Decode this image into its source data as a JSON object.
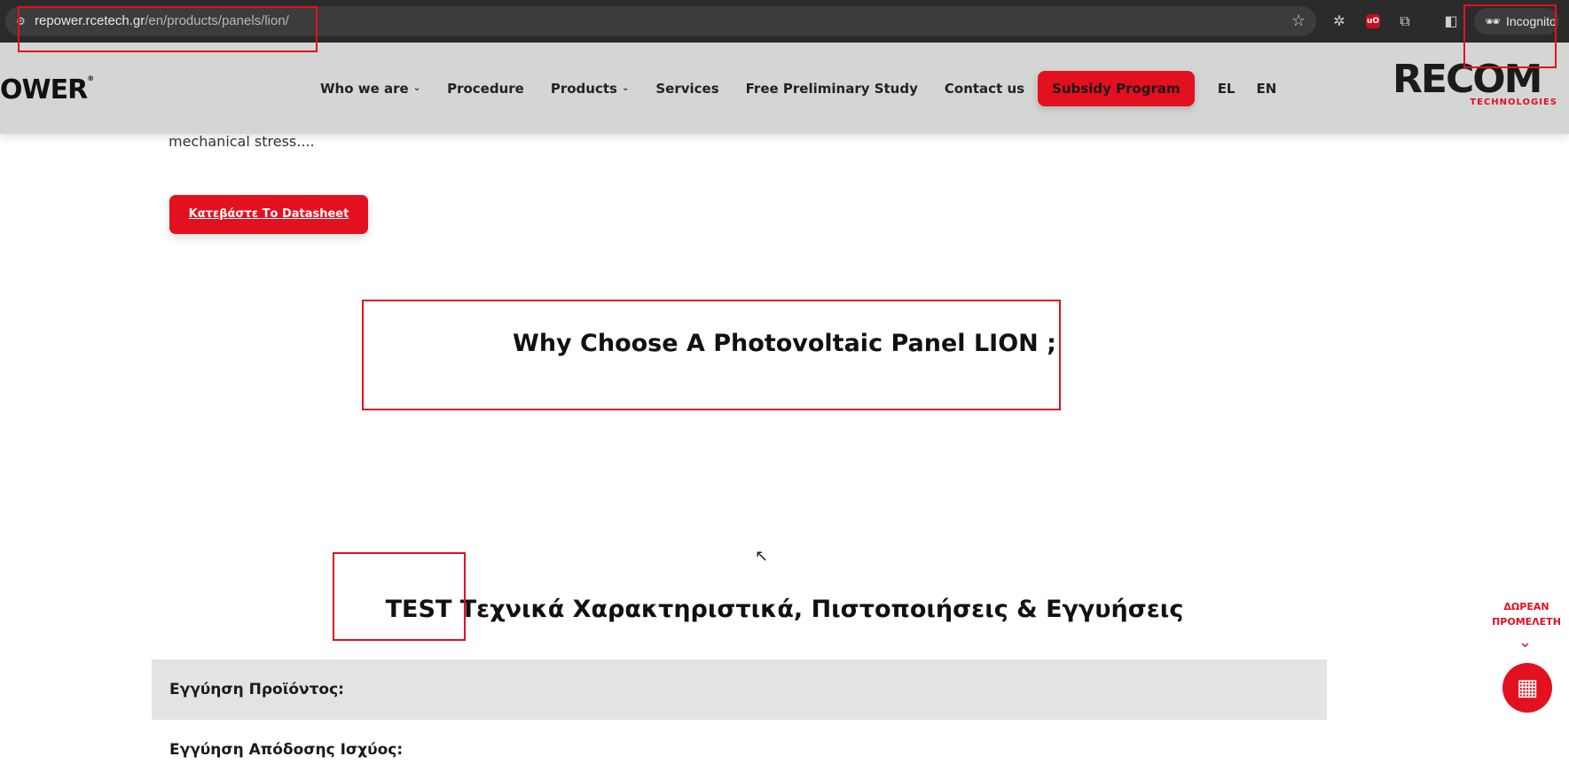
{
  "browser": {
    "url_host": "repower.rcetech.gr",
    "url_path": "/en/products/panels/lion/",
    "incognito_label": "Incognito",
    "ublock_label": "uO"
  },
  "header": {
    "logo_left": "OWER",
    "logo_right_brand": "RECOM",
    "logo_right_sub": "TECHNOLOGIES",
    "nav": [
      {
        "label": "Who we are",
        "has_dropdown": true
      },
      {
        "label": "Procedure",
        "has_dropdown": false
      },
      {
        "label": "Products",
        "has_dropdown": true
      },
      {
        "label": "Services",
        "has_dropdown": false
      },
      {
        "label": "Free Preliminary Study",
        "has_dropdown": false
      },
      {
        "label": "Contact us",
        "has_dropdown": false
      }
    ],
    "cta_label": "Subsidy Program",
    "lang_el": "EL",
    "lang_en": "EN"
  },
  "content": {
    "intro_tail": "mechanical stress....",
    "datasheet_button": "Κατεβάστε Το Datasheet",
    "why_title": "Why Choose A Photovoltaic Panel LION ;",
    "specs_title": "TEST Τεχνικά Χαρακτηριστικά, Πιστοποιήσεις & Εγγυήσεις",
    "spec_rows": [
      {
        "label": "Εγγύηση Προϊόντος:"
      },
      {
        "label": "Εγγύηση Απόδοσης Ισχύος:"
      }
    ]
  },
  "floating": {
    "free_study_line1": "ΔΩΡΕΑΝ",
    "free_study_line2": "ΠΡΟΜΕΛΕΤΗ"
  },
  "colors": {
    "accent": "#e3101f",
    "header_bg": "#d4d6d6",
    "chrome_bg": "#2b2b2b"
  }
}
